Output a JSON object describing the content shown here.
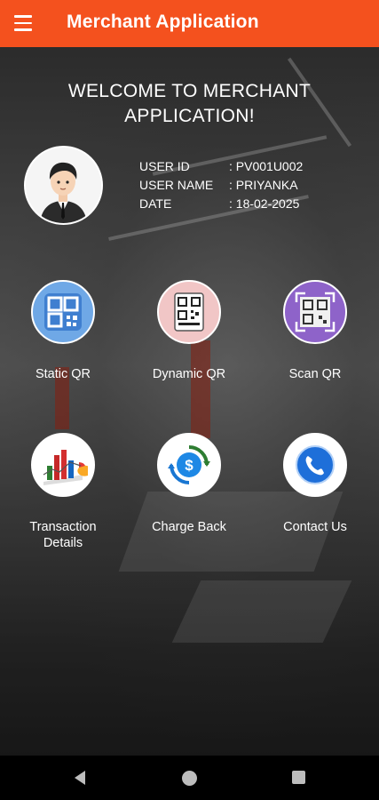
{
  "app_bar": {
    "title": "Merchant Application",
    "color": "#f4511e",
    "menu_icon": "hamburger-menu-icon"
  },
  "welcome": {
    "line1": "WELCOME TO MERCHANT",
    "line2": "APPLICATION!"
  },
  "user_info": {
    "rows": [
      {
        "label": "USER ID",
        "value": ": PV001U002"
      },
      {
        "label": "USER NAME",
        "value": ": PRIYANKA"
      },
      {
        "label": "DATE",
        "value": ": 18-02-2025"
      }
    ]
  },
  "tiles": [
    {
      "label": "Static QR",
      "icon": "static-qr-icon"
    },
    {
      "label": "Dynamic QR",
      "icon": "dynamic-qr-icon"
    },
    {
      "label": "Scan QR",
      "icon": "scan-qr-icon"
    },
    {
      "label": "Transaction Details",
      "label_line1": "Transaction",
      "label_line2": "Details",
      "icon": "transaction-chart-icon"
    },
    {
      "label": "Charge Back",
      "icon": "charge-back-dollar-icon"
    },
    {
      "label": "Contact Us",
      "icon": "phone-icon"
    }
  ],
  "nav_bar": {
    "icons": [
      "back-icon",
      "home-icon",
      "recents-icon"
    ]
  }
}
